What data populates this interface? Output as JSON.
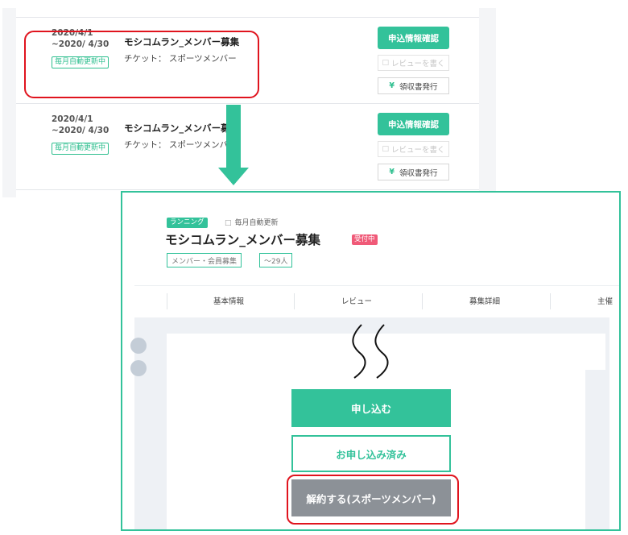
{
  "list": {
    "rows": [
      {
        "date": "2020/4/1 ~2020/ 4/30",
        "auto_renew_badge": "毎月自動更新中",
        "title": "モシコムラン_メンバー募集",
        "ticket": "チケット： スポーツメンバー",
        "confirm_label": "申込情報確認",
        "review_label": "レビューを書く",
        "receipt_label": "領収書発行"
      },
      {
        "date": "2020/4/1 ~2020/ 4/30",
        "auto_renew_badge": "毎月自動更新中",
        "title": "モシコムラン_メンバー募集",
        "ticket": "チケット： スポーツメンバー",
        "confirm_label": "申込情報確認",
        "review_label": "レビューを書く",
        "receipt_label": "領収書発行"
      }
    ],
    "yen_icon": "¥",
    "review_icon": "comment-icon"
  },
  "detail": {
    "category_badge": "ランニング",
    "monthly_label": "毎月自動更新",
    "title": "モシコムラン_メンバー募集",
    "status_badge": "受付中",
    "tags": [
      "メンバー・会員募集",
      "～29人"
    ],
    "tabs": [
      "基本情報",
      "レビュー",
      "募集詳細",
      "主催"
    ],
    "apply_label": "申し込む",
    "applied_label": "お申し込み済み",
    "cancel_label": "解約する(スポーツメンバー)"
  },
  "colors": {
    "accent": "#33c29a",
    "highlight": "#e0141e",
    "status": "#f05a78",
    "cancel": "#8c9197"
  }
}
